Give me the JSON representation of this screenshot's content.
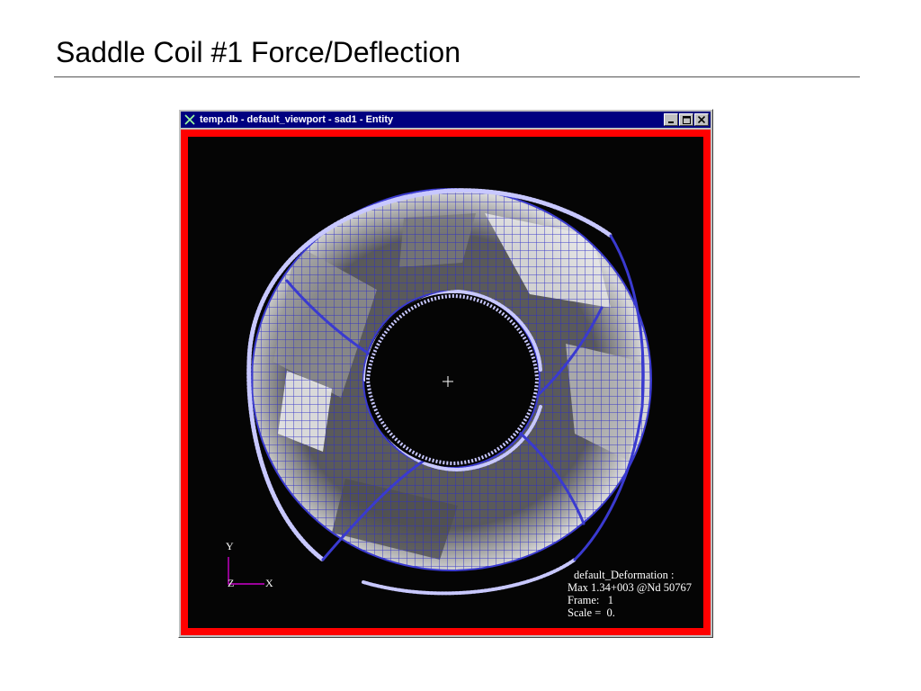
{
  "slide": {
    "title": "Saddle Coil #1 Force/Deflection"
  },
  "window": {
    "title": "temp.db - default_viewport - sad1 - Entity",
    "controls": {
      "minimize": "_",
      "maximize": "□",
      "close": "×"
    }
  },
  "viewport": {
    "triad": {
      "y": "Y",
      "z": "Z",
      "x": "X"
    },
    "info": {
      "line1": "default_Deformation :",
      "line2": "Max 1.34+003 @Nd 50767",
      "line3": "Frame:   1",
      "line4": "Scale =  0."
    }
  },
  "colors": {
    "frame": "#ff0000",
    "titlebar": "#000080",
    "mesh": "#3a3ad0"
  }
}
